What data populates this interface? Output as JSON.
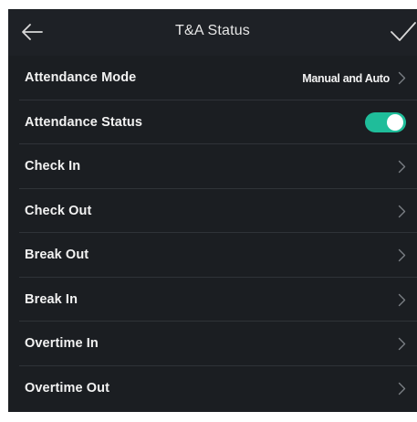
{
  "header": {
    "title": "T&A Status"
  },
  "settings": {
    "attendance_mode": {
      "label": "Attendance Mode",
      "value": "Manual and Auto"
    },
    "attendance_status": {
      "label": "Attendance Status",
      "enabled": true
    },
    "items": [
      {
        "label": "Check In"
      },
      {
        "label": "Check Out"
      },
      {
        "label": "Break Out"
      },
      {
        "label": "Break In"
      },
      {
        "label": "Overtime In"
      },
      {
        "label": "Overtime Out"
      }
    ]
  },
  "icons": {
    "back": "back-arrow-icon",
    "confirm": "checkmark-icon",
    "chevron": "chevron-right-icon"
  },
  "colors": {
    "background": "#1b1e22",
    "toggle_on": "#1fbd9a",
    "text": "#f2f2f2",
    "chevron": "#7a7e84"
  }
}
